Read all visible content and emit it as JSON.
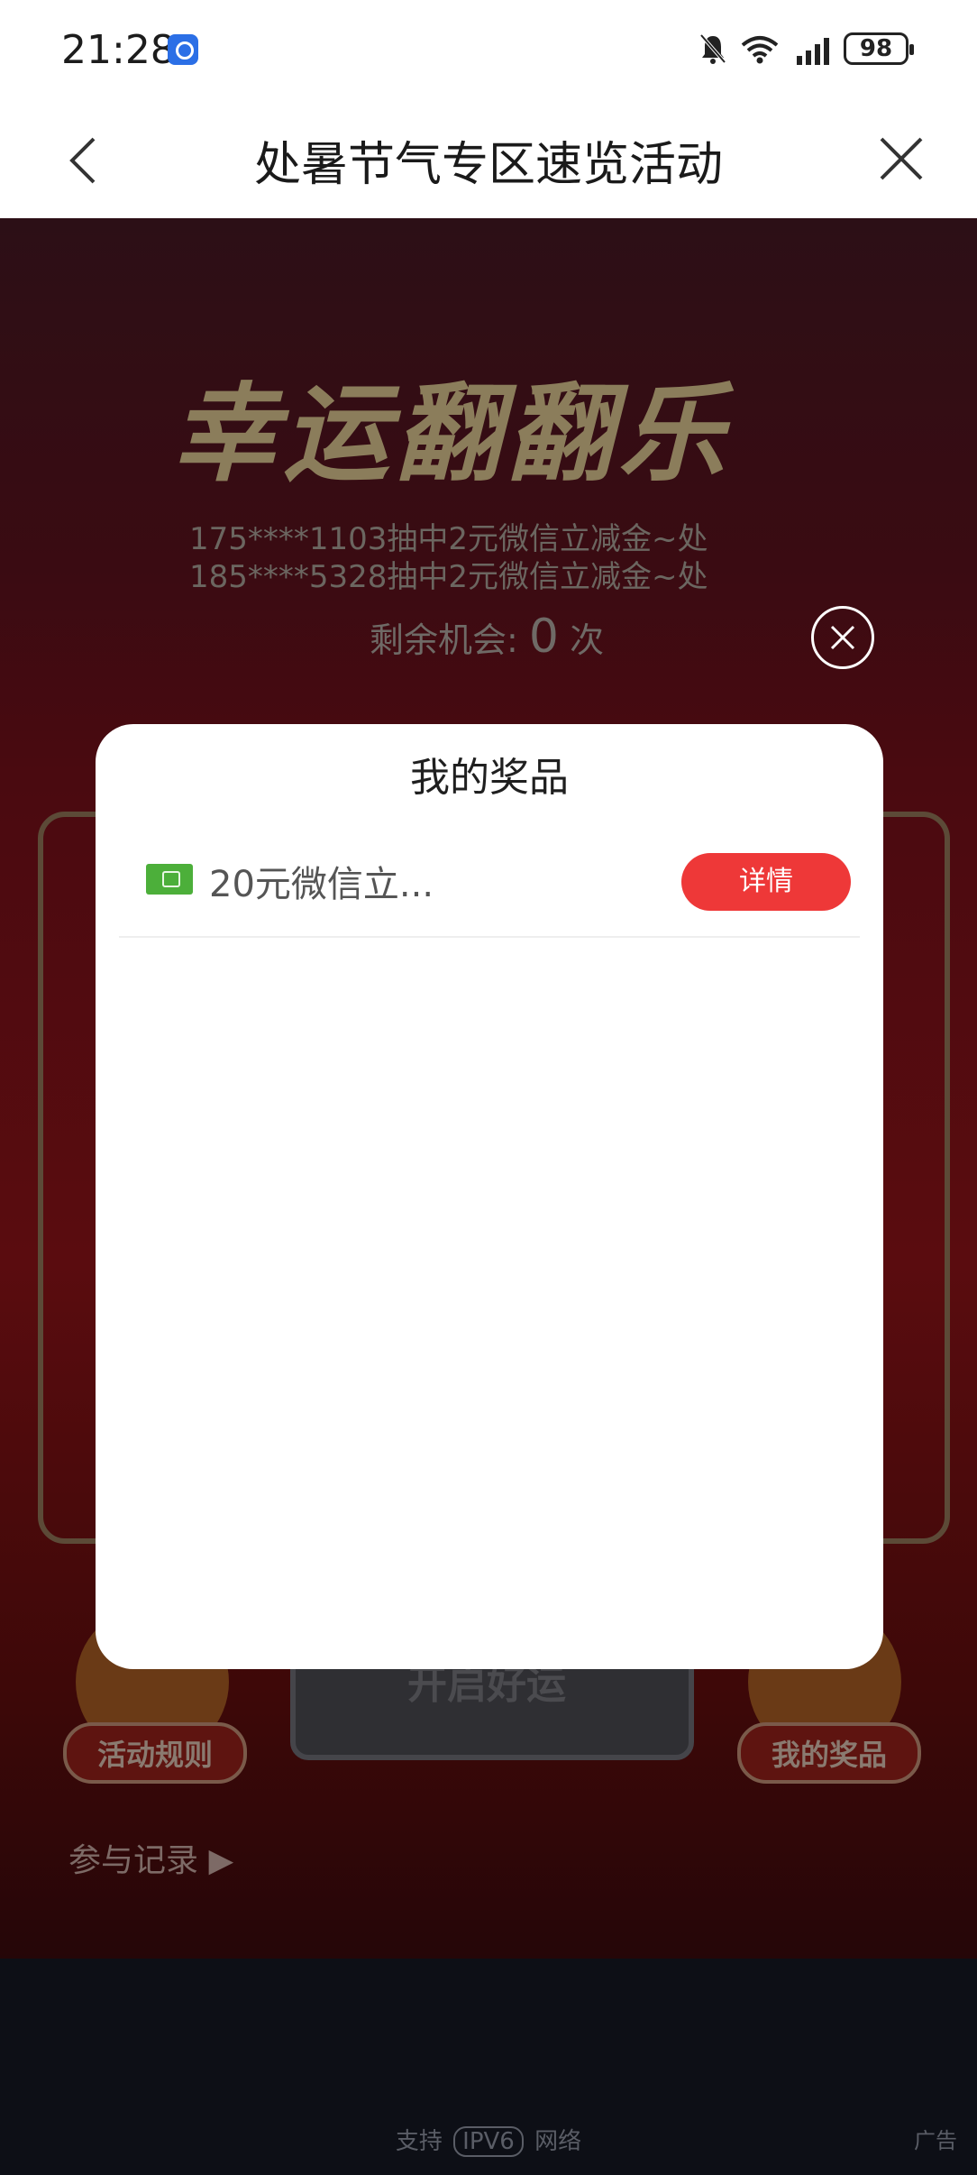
{
  "status_bar": {
    "time": "21:28",
    "battery": "98"
  },
  "header": {
    "title": "处暑节气专区速览活动"
  },
  "game": {
    "title": "幸运翻翻乐",
    "scroll_lines": [
      "175****1103抽中2元微信立减金~处",
      "185****5328抽中2元微信立减金~处"
    ],
    "remaining_label": "剩余机会:",
    "remaining_count": "0",
    "remaining_unit": "次",
    "start_button": "开启好运",
    "rules_button": "活动规则",
    "my_prizes_button": "我的奖品",
    "records_link": "参与记录 ▶"
  },
  "modal": {
    "title": "我的奖品",
    "prizes": [
      {
        "name": "20元微信立...",
        "action": "详情"
      }
    ]
  },
  "footer": {
    "support_prefix": "支持",
    "ipv6": "IPV6",
    "support_suffix": "网络",
    "ad": "广告"
  }
}
